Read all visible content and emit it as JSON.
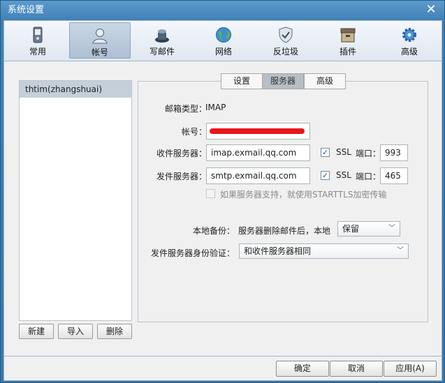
{
  "window": {
    "title": "系统设置"
  },
  "toolbar": {
    "items": [
      {
        "label": "常用",
        "icon": "phone-icon"
      },
      {
        "label": "帐号",
        "icon": "user-icon",
        "active": true
      },
      {
        "label": "写邮件",
        "icon": "pen-inkwell-icon"
      },
      {
        "label": "网络",
        "icon": "globe-icon"
      },
      {
        "label": "反垃圾",
        "icon": "shield-icon"
      },
      {
        "label": "插件",
        "icon": "box-icon"
      },
      {
        "label": "高级",
        "icon": "gear-icon"
      }
    ]
  },
  "accounts": {
    "items": [
      {
        "label": "thtim(zhangshuai)"
      }
    ],
    "new_label": "新建",
    "import_label": "导入",
    "delete_label": "删除"
  },
  "tabs": [
    {
      "label": "设置"
    },
    {
      "label": "服务器",
      "active": true
    },
    {
      "label": "高级"
    }
  ],
  "server": {
    "mailbox_type_label": "邮箱类型：",
    "mailbox_type_value": "IMAP",
    "account_label": "帐号：",
    "incoming_label": "收件服务器：",
    "incoming_value": "imap.exmail.qq.com",
    "incoming_ssl_label": "SSL",
    "incoming_port_label": "端口：",
    "incoming_port": "993",
    "outgoing_label": "发件服务器：",
    "outgoing_value": "smtp.exmail.qq.com",
    "outgoing_ssl_label": "SSL",
    "outgoing_port_label": "端口：",
    "outgoing_port": "465",
    "starttls_label": "如果服务器支持，就使用STARTTLS加密传输",
    "backup_label": "本地备份：",
    "backup_desc": "服务器删除邮件后，本地",
    "backup_value": "保留",
    "auth_label": "发件服务器身份验证：",
    "auth_value": "和收件服务器相同"
  },
  "footer": {
    "ok_label": "确定",
    "cancel_label": "取消",
    "apply_label": "应用(A)"
  },
  "colors": {
    "accent": "#3f7fb4",
    "redaction": "#e8141b"
  }
}
